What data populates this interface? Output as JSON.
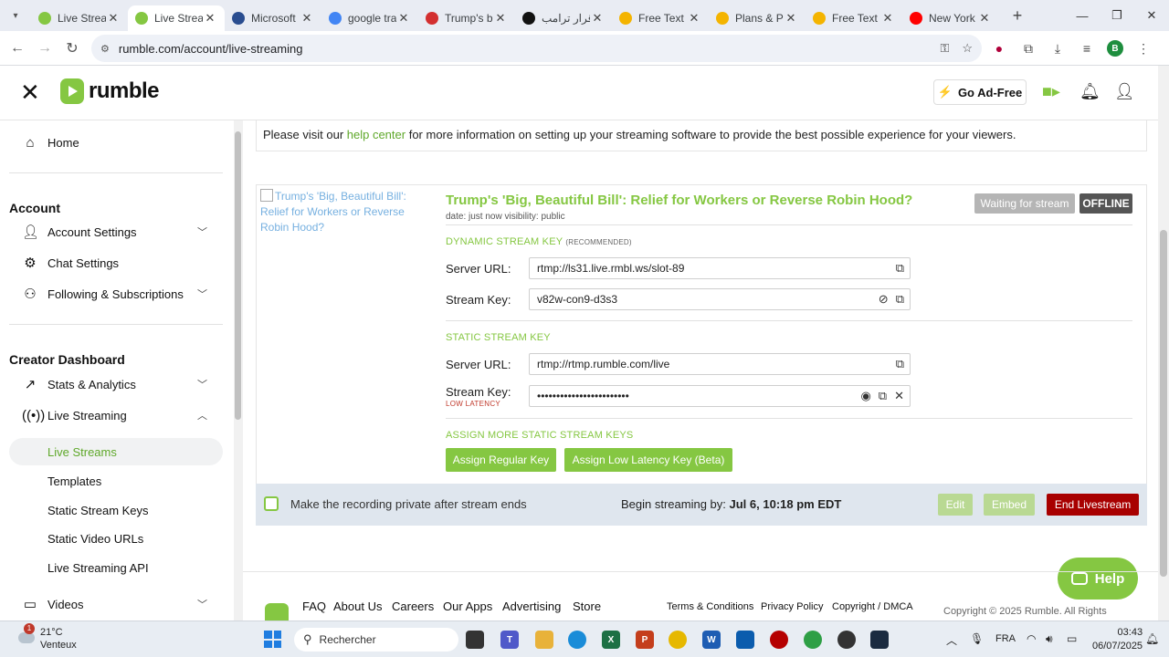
{
  "browser": {
    "tabs": [
      {
        "title": "Live Strean",
        "fav_color": "#85c742",
        "active": false
      },
      {
        "title": "Live Strean",
        "fav_color": "#85c742",
        "active": true
      },
      {
        "title": "Microsoft",
        "fav_color": "#2a4d8f",
        "active": false
      },
      {
        "title": "google tra",
        "fav_color": "#4285f4",
        "active": false
      },
      {
        "title": "Trump's b",
        "fav_color": "#d32f2f",
        "active": false
      },
      {
        "title": "قرار ترامب",
        "fav_color": "#111111",
        "active": false
      },
      {
        "title": "Free Text t",
        "fav_color": "#f4b400",
        "active": false
      },
      {
        "title": "Plans & Pr",
        "fav_color": "#f4b400",
        "active": false
      },
      {
        "title": "Free Text t",
        "fav_color": "#f4b400",
        "active": false
      },
      {
        "title": "New York",
        "fav_color": "#ff0000",
        "active": false
      }
    ],
    "url": "rumble.com/account/live-streaming",
    "profile_initial": "B"
  },
  "header": {
    "logo_text": "rumble",
    "go_adfree": "Go Ad-Free"
  },
  "sidebar": {
    "home": "Home",
    "account_title": "Account",
    "account_settings": "Account Settings",
    "chat_settings": "Chat Settings",
    "following": "Following & Subscriptions",
    "creator_title": "Creator Dashboard",
    "stats": "Stats & Analytics",
    "live_streaming": "Live Streaming",
    "sub_items": [
      "Live Streams",
      "Templates",
      "Static Stream Keys",
      "Static Video URLs",
      "Live Streaming API"
    ],
    "videos": "Videos"
  },
  "help_notice": {
    "before": "Please visit our ",
    "link": "help center",
    "after": " for more information on setting up your streaming software to provide the best possible experience for your viewers."
  },
  "stream": {
    "thumb_alt": "Trump's 'Big, Beautiful Bill': Relief for Workers or Reverse Robin Hood?",
    "title": "Trump's 'Big, Beautiful Bill': Relief for Workers or Reverse Robin Hood?",
    "meta": "date: just now   visibility: public",
    "status_waiting": "Waiting for stream",
    "status_offline": "OFFLINE",
    "dynamic_heading": "DYNAMIC STREAM KEY",
    "dynamic_rec": "(RECOMMENDED)",
    "server_url_label": "Server URL:",
    "stream_key_label": "Stream Key:",
    "dynamic_server_url": "rtmp://ls31.live.rmbl.ws/slot-89",
    "dynamic_stream_key": "v82w-con9-d3s3",
    "static_heading": "STATIC STREAM KEY",
    "static_server_url": "rtmp://rtmp.rumble.com/live",
    "low_latency": "LOW LATENCY",
    "static_stream_key": "••••••••••••••••••••••••",
    "assign_heading": "ASSIGN MORE STATIC STREAM KEYS",
    "assign_regular": "Assign Regular Key",
    "assign_low": "Assign Low Latency Key (Beta)",
    "private_label": "Make the recording private after stream ends",
    "begin_label": "Begin streaming by: ",
    "begin_value": "Jul 6, 10:18 pm EDT",
    "edit": "Edit",
    "embed": "Embed",
    "end": "End Livestream"
  },
  "help_button": "Help",
  "footer": {
    "links": [
      "FAQ",
      "About Us",
      "Careers",
      "Our Apps",
      "Advertising",
      "Store"
    ],
    "small_links": [
      "Terms & Conditions",
      "Privacy Policy",
      "Copyright / DMCA"
    ],
    "copyright": "Copyright © 2025 Rumble. All Rights"
  },
  "taskbar": {
    "temp": "21°C",
    "weather": "Venteux",
    "weather_badge": "1",
    "search_placeholder": "Rechercher",
    "lang": "FRA",
    "time": "03:43",
    "date": "06/07/2025"
  }
}
